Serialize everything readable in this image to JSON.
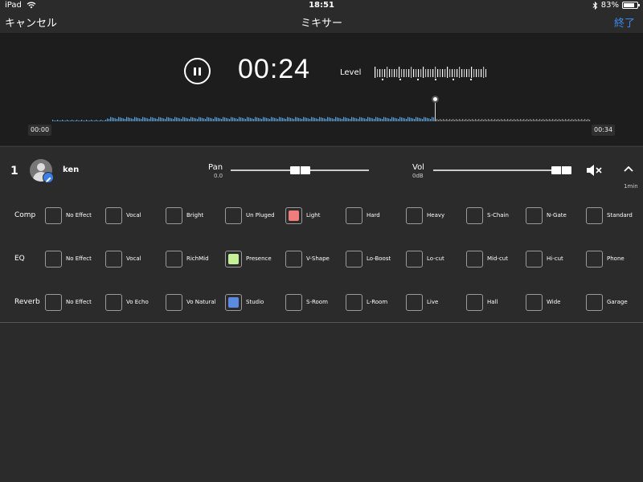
{
  "status_bar": {
    "device": "iPad",
    "time": "18:51",
    "battery": "83%",
    "battery_level": 0.83
  },
  "nav": {
    "cancel": "キャンセル",
    "title": "ミキサー",
    "done": "終了"
  },
  "transport": {
    "elapsed": "00:24",
    "level_label": "Level",
    "start_time": "00:00",
    "end_time": "00:34",
    "playhead_fraction": 0.71
  },
  "track": {
    "number": "1",
    "name": "ken",
    "pan_label": "Pan",
    "pan_value": "0.0",
    "vol_label": "Vol",
    "vol_value": "0dB",
    "duration": "1min"
  },
  "colors": {
    "accent": "#3c8af0",
    "comp_selected": "#f07c7c",
    "eq_selected": "#c5f09a",
    "reverb_selected": "#5b8be0"
  },
  "effects": {
    "comp": {
      "label": "Comp",
      "selected": "Light",
      "options": [
        "No Effect",
        "Vocal",
        "Bright",
        "Un Pluged",
        "Light",
        "Hard",
        "Heavy",
        "S-Chain",
        "N-Gate",
        "Standard"
      ]
    },
    "eq": {
      "label": "EQ",
      "selected": "Presence",
      "options": [
        "No Effect",
        "Vocal",
        "RichMid",
        "Presence",
        "V-Shape",
        "Lo-Boost",
        "Lo-cut",
        "Mid-cut",
        "Hi-cut",
        "Phone"
      ]
    },
    "reverb": {
      "label": "Reverb",
      "selected": "Studio",
      "options": [
        "No Effect",
        "Vo Echo",
        "Vo Natural",
        "Studio",
        "S-Room",
        "L-Room",
        "Live",
        "Hall",
        "Wide",
        "Garage"
      ]
    }
  }
}
